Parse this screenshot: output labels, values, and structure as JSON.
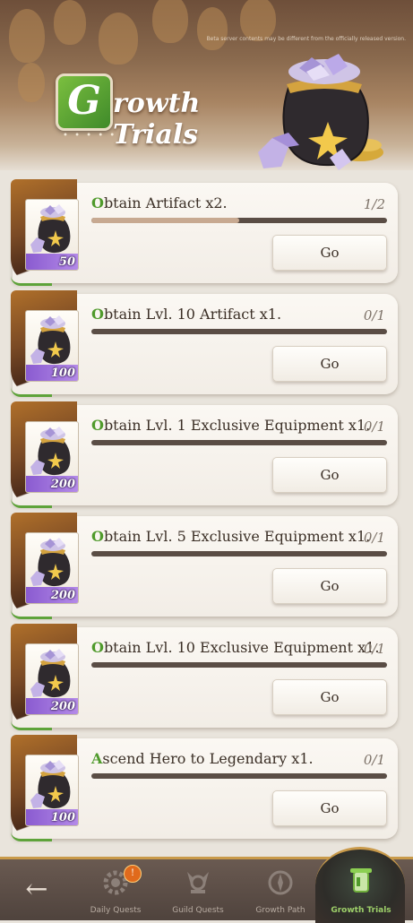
{
  "header": {
    "title_initial": "G",
    "title_rest": "rowth Trials",
    "disclaimer": "Beta server contents may be different from the officially released version.",
    "dots": "• • • • • •"
  },
  "quests": [
    {
      "cap": "O",
      "rest": "btain Artifact x2.",
      "progress": "1/2",
      "fraction": 0.5,
      "reward_qty": "50",
      "button": "Go"
    },
    {
      "cap": "O",
      "rest": "btain Lvl. 10 Artifact x1.",
      "progress": "0/1",
      "fraction": 0,
      "reward_qty": "100",
      "button": "Go"
    },
    {
      "cap": "O",
      "rest": "btain Lvl. 1 Exclusive Equipment x1.",
      "progress": "0/1",
      "fraction": 0,
      "reward_qty": "200",
      "button": "Go"
    },
    {
      "cap": "O",
      "rest": "btain Lvl. 5 Exclusive Equipment x1.",
      "progress": "0/1",
      "fraction": 0,
      "reward_qty": "200",
      "button": "Go"
    },
    {
      "cap": "O",
      "rest": "btain Lvl. 10 Exclusive Equipment x1.",
      "progress": "0/1",
      "fraction": 0,
      "reward_qty": "200",
      "button": "Go"
    },
    {
      "cap": "A",
      "rest": "scend Hero to Legendary x1.",
      "progress": "0/1",
      "fraction": 0,
      "reward_qty": "100",
      "button": "Go"
    }
  ],
  "nav": {
    "back_icon": "back-arrow-icon",
    "items": [
      {
        "label": "Daily Quests",
        "icon": "gear-icon",
        "badge": "!"
      },
      {
        "label": "Guild Quests",
        "icon": "guild-emblem-icon"
      },
      {
        "label": "Growth Path",
        "icon": "compass-icon"
      },
      {
        "label": "Growth Trials",
        "icon": "scroll-icon",
        "active": true
      }
    ]
  },
  "colors": {
    "accent_green": "#4f9a2b",
    "gold_trim": "#c99a4a",
    "reward_purple": "#8a5bd0"
  }
}
